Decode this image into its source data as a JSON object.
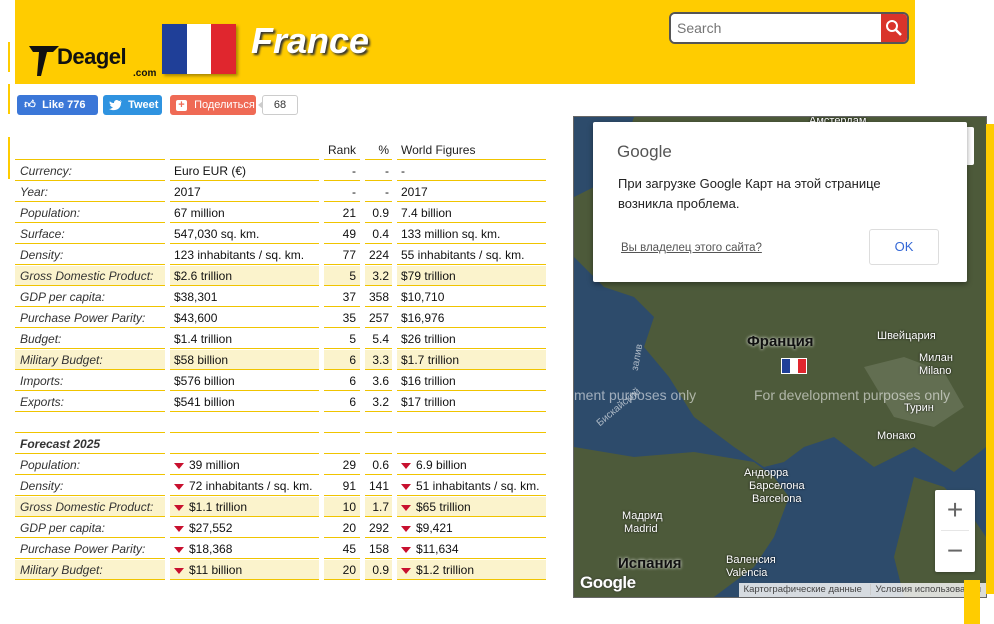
{
  "header": {
    "logo_text": "Deagel",
    "logo_sub": ".com",
    "country": "France",
    "flag_colors": [
      "#1f3f98",
      "#ffffff",
      "#e0262e"
    ],
    "search_placeholder": "Search",
    "search_icon": "search-icon"
  },
  "social": {
    "like_label": "Like 776",
    "tweet_label": "Tweet",
    "share_label": "Поделиться",
    "share_count": "68"
  },
  "table": {
    "headers": {
      "rank": "Rank",
      "pct": "%",
      "world": "World Figures"
    },
    "rows": [
      {
        "label": "Currency:",
        "value": "Euro EUR (€)",
        "rank": "-",
        "pct": "-",
        "world": "-",
        "hl": false
      },
      {
        "label": "Year:",
        "value": "2017",
        "rank": "-",
        "pct": "-",
        "world": "2017",
        "hl": false
      },
      {
        "label": "Population:",
        "value": "67 million",
        "rank": "21",
        "pct": "0.9",
        "world": "7.4 billion",
        "hl": false
      },
      {
        "label": "Surface:",
        "value": "547,030 sq. km.",
        "rank": "49",
        "pct": "0.4",
        "world": "133 million sq. km.",
        "hl": false
      },
      {
        "label": "Density:",
        "value": "123 inhabitants / sq. km.",
        "rank": "77",
        "pct": "224",
        "world": "55 inhabitants / sq. km.",
        "hl": false
      },
      {
        "label": "Gross Domestic Product:",
        "value": "$2.6 trillion",
        "rank": "5",
        "pct": "3.2",
        "world": "$79 trillion",
        "hl": true
      },
      {
        "label": "GDP per capita:",
        "value": "$38,301",
        "rank": "37",
        "pct": "358",
        "world": "$10,710",
        "hl": false
      },
      {
        "label": "Purchase Power Parity:",
        "value": "$43,600",
        "rank": "35",
        "pct": "257",
        "world": "$16,976",
        "hl": false
      },
      {
        "label": "Budget:",
        "value": "$1.4 trillion",
        "rank": "5",
        "pct": "5.4",
        "world": "$26 trillion",
        "hl": false
      },
      {
        "label": "Military Budget:",
        "value": "$58 billion",
        "rank": "6",
        "pct": "3.3",
        "world": "$1.7 trillion",
        "hl": true
      },
      {
        "label": "Imports:",
        "value": "$576 billion",
        "rank": "6",
        "pct": "3.6",
        "world": "$16 trillion",
        "hl": false
      },
      {
        "label": "Exports:",
        "value": "$541 billion",
        "rank": "6",
        "pct": "3.2",
        "world": "$17 trillion",
        "hl": false
      }
    ],
    "forecast_title": "Forecast 2025",
    "forecast_rows": [
      {
        "label": "Population:",
        "value": "39 million",
        "rank": "29",
        "pct": "0.6",
        "world": "6.9 billion",
        "hl": false
      },
      {
        "label": "Density:",
        "value": "72 inhabitants / sq. km.",
        "rank": "91",
        "pct": "141",
        "world": "51 inhabitants / sq. km.",
        "hl": false
      },
      {
        "label": "Gross Domestic Product:",
        "value": "$1.1 trillion",
        "rank": "10",
        "pct": "1.7",
        "world": "$65 trillion",
        "hl": true
      },
      {
        "label": "GDP per capita:",
        "value": "$27,552",
        "rank": "20",
        "pct": "292",
        "world": "$9,421",
        "hl": false
      },
      {
        "label": "Purchase Power Parity:",
        "value": "$18,368",
        "rank": "45",
        "pct": "158",
        "world": "$11,634",
        "hl": false
      },
      {
        "label": "Military Budget:",
        "value": "$11 billion",
        "rank": "20",
        "pct": "0.9",
        "world": "$1.2 trillion",
        "hl": true
      }
    ]
  },
  "map": {
    "dialog_brand": "Google",
    "dialog_message": "При загрузке Google Карт на этой странице возникла проблема.",
    "dialog_owner_link": "Вы владелец этого сайта?",
    "dialog_ok": "OK",
    "watermark_left": "ment purposes only",
    "watermark_right": "For development purposes only",
    "labels": {
      "amsterdam": "Амстердам",
      "france": "Франция",
      "switzerland": "Швейцария",
      "milan": "Милан",
      "milano": "Milano",
      "turin": "Турин",
      "monaco": "Монако",
      "andorra": "Андорра",
      "barcelona_ru": "Барселона",
      "barcelona": "Barcelona",
      "madrid_ru": "Мадрид",
      "madrid": "Madrid",
      "spain": "Испания",
      "valencia_ru": "Валенсия",
      "valencia": "València",
      "biscay1": "Бискайский",
      "biscay2": "залив"
    },
    "zoom_in": "+",
    "zoom_out": "−",
    "footer_data": "Картографические данные",
    "footer_terms": "Условия использования",
    "google_logo": "Google",
    "land_color": "#4d5a3a",
    "sea_color": "#2d4b6b"
  }
}
